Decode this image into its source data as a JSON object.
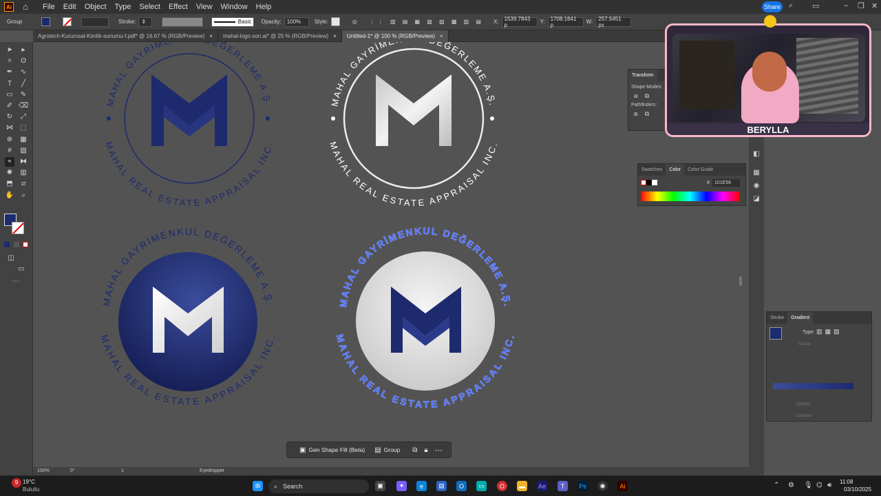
{
  "app": {
    "menu": [
      "File",
      "Edit",
      "Object",
      "Type",
      "Select",
      "Effect",
      "View",
      "Window",
      "Help"
    ],
    "share_label": "Share",
    "logo_text": "Ai"
  },
  "control_bar": {
    "selection_label": "Group",
    "stroke_label": "Stroke:",
    "brush_label": "Basic",
    "opacity_label": "Opacity:",
    "opacity_value": "100%",
    "style_label": "Style:",
    "x_label": "X:",
    "x_value": "1539.7843 p",
    "y_label": "Y:",
    "y_value": "1708.1641 p",
    "w_label": "W:",
    "w_value": "257.5451 px"
  },
  "tabs": [
    {
      "label": "Agrotech-Kurumsal-Kimlik-sunumu-f.pdf* @ 16.67 % (RGB/Preview)",
      "active": false
    },
    {
      "label": "mahal-logo-son.ai* @ 25 % (RGB/Preview)",
      "active": false
    },
    {
      "label": "Untitled-1* @ 100 % (RGB/Preview)",
      "active": true
    }
  ],
  "artwork": {
    "top_text_tr": "MAHAL GAYRİMENKUL DEĞERLEME A.Ş.",
    "bottom_text_en": "MAHAL REAL ESTATE APPRAISAL INC.",
    "navy": "#1e2a6e",
    "navy_dark": "#141d52",
    "selection_blue": "#4f6fff"
  },
  "panels": {
    "transform_tab": "Transform",
    "shape_modes": "Shape Modes:",
    "pathfinders": "Pathfinders:",
    "color_tabs": [
      "Swatches",
      "Color",
      "Color Guide"
    ],
    "color_active": "Color",
    "hex_label": "#",
    "hex_value": "101E56",
    "gradient_tabs": [
      "Stroke",
      "Gradient"
    ],
    "gradient_active": "Gradient",
    "gradient_type_label": "Type:",
    "stroke_sub": "Stroke:",
    "opacity_sub": "Opacity:",
    "location_sub": "Location:"
  },
  "context_bar": {
    "gen_fill": "Gen Shape Fill (Beta)",
    "group": "Group"
  },
  "status": {
    "zoom": "100%",
    "rotation": "0°",
    "artboard": "1",
    "tool": "Eyedropper"
  },
  "webcam": {
    "name": "BERYLLA"
  },
  "taskbar": {
    "temp": "19°C",
    "weather": "Bulutlu",
    "search": "Search",
    "time": "11:08",
    "date": "03/10/2025",
    "badge": "9"
  }
}
